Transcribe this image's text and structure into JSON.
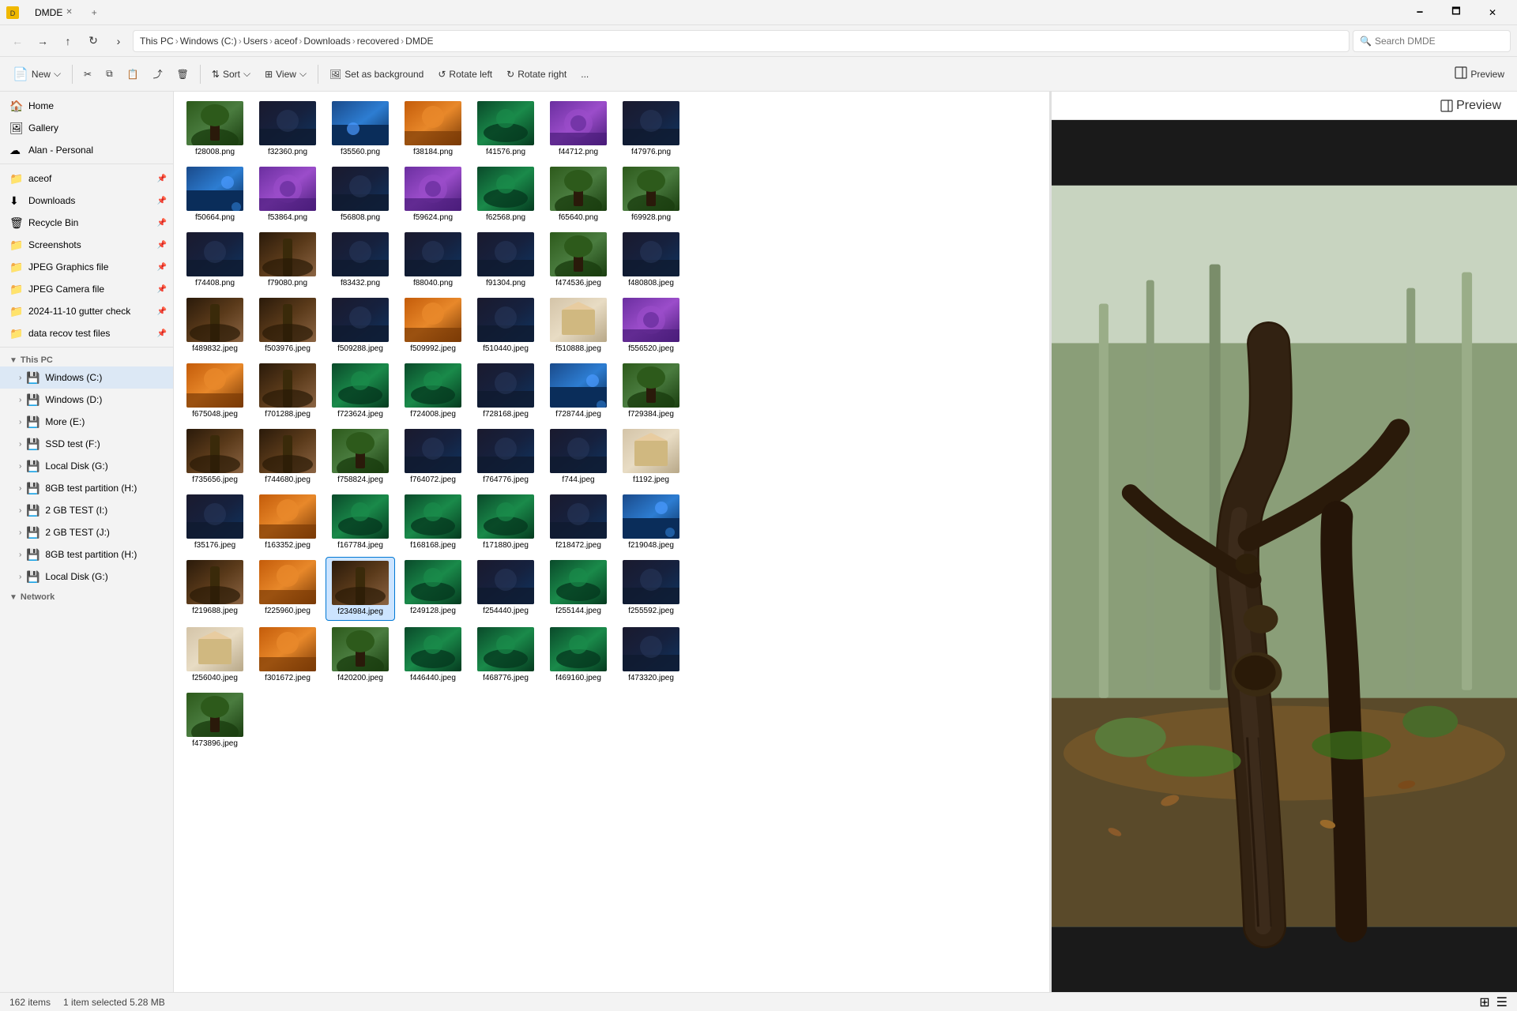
{
  "window": {
    "title": "DMDE",
    "tab_label": "DMDE",
    "minimize": "—",
    "maximize": "□",
    "close": "✕",
    "add_tab": "+"
  },
  "titlebar_controls": {
    "minimize": "🗕",
    "maximize": "🗖",
    "close": "✕"
  },
  "addressbar": {
    "back": "←",
    "forward": "→",
    "up": "↑",
    "refresh": "↻",
    "expand": "›",
    "breadcrumbs": [
      "This PC",
      "Windows (C:)",
      "Users",
      "aceof",
      "Downloads",
      "recovered",
      "DMDE"
    ],
    "search_placeholder": "Search DMDE"
  },
  "toolbar": {
    "new_label": "New",
    "cut_icon": "✂",
    "copy_icon": "⧉",
    "paste_icon": "📋",
    "share_icon": "⤴",
    "delete_icon": "🗑",
    "sort_label": "Sort",
    "view_label": "View",
    "set_background_label": "Set as background",
    "rotate_left_label": "Rotate left",
    "rotate_right_label": "Rotate right",
    "more_icon": "...",
    "preview_label": "Preview"
  },
  "sidebar": {
    "sections": [
      {
        "type": "item",
        "label": "Home",
        "icon": "🏠",
        "indent": 0
      },
      {
        "type": "item",
        "label": "Gallery",
        "icon": "🖼",
        "indent": 0
      },
      {
        "type": "item",
        "label": "Alan - Personal",
        "icon": "☁",
        "indent": 0
      },
      {
        "type": "separator"
      },
      {
        "type": "item",
        "label": "aceof",
        "icon": "📁",
        "indent": 0,
        "pin": true
      },
      {
        "type": "item",
        "label": "Downloads",
        "icon": "⬇",
        "indent": 0,
        "pin": true
      },
      {
        "type": "item",
        "label": "Recycle Bin",
        "icon": "🗑",
        "indent": 0,
        "pin": true
      },
      {
        "type": "item",
        "label": "Screenshots",
        "icon": "📁",
        "indent": 0,
        "pin": true
      },
      {
        "type": "item",
        "label": "JPEG Graphics file",
        "icon": "📁",
        "indent": 0,
        "pin": true
      },
      {
        "type": "item",
        "label": "JPEG Camera file",
        "icon": "📁",
        "indent": 0,
        "pin": true
      },
      {
        "type": "item",
        "label": "2024-11-10 gutter check",
        "icon": "📁",
        "indent": 0,
        "pin": true
      },
      {
        "type": "item",
        "label": "data recov test files",
        "icon": "📁",
        "indent": 0,
        "pin": true
      },
      {
        "type": "separator"
      },
      {
        "type": "section",
        "label": "This PC",
        "collapsed": false
      },
      {
        "type": "item",
        "label": "Windows (C:)",
        "icon": "💾",
        "indent": 1,
        "has_arrow": true,
        "active": true
      },
      {
        "type": "item",
        "label": "Windows (D:)",
        "icon": "💾",
        "indent": 1,
        "has_arrow": true
      },
      {
        "type": "item",
        "label": "More (E:)",
        "icon": "💾",
        "indent": 1,
        "has_arrow": true
      },
      {
        "type": "item",
        "label": "SSD test (F:)",
        "icon": "💾",
        "indent": 1,
        "has_arrow": true
      },
      {
        "type": "item",
        "label": "Local Disk (G:)",
        "icon": "💾",
        "indent": 1,
        "has_arrow": true
      },
      {
        "type": "item",
        "label": "8GB test partition (H:)",
        "icon": "💾",
        "indent": 1,
        "has_arrow": true
      },
      {
        "type": "item",
        "label": "2 GB TEST (I:)",
        "icon": "💾",
        "indent": 1,
        "has_arrow": true
      },
      {
        "type": "item",
        "label": "2 GB TEST (J:)",
        "icon": "💾",
        "indent": 1,
        "has_arrow": true
      },
      {
        "type": "item",
        "label": "8GB test partition (H:)",
        "icon": "💾",
        "indent": 1,
        "has_arrow": true
      },
      {
        "type": "item",
        "label": "Local Disk (G:)",
        "icon": "💾",
        "indent": 1,
        "has_arrow": true
      },
      {
        "type": "section",
        "label": "Network",
        "collapsed": false
      }
    ]
  },
  "files": [
    {
      "name": "f28008.png",
      "color": "forest",
      "selected": false
    },
    {
      "name": "f32360.png",
      "color": "dark",
      "selected": false
    },
    {
      "name": "f35560.png",
      "color": "fantasy",
      "selected": false
    },
    {
      "name": "f38184.png",
      "color": "orange",
      "selected": false
    },
    {
      "name": "f41576.png",
      "color": "alien",
      "selected": false
    },
    {
      "name": "f44712.png",
      "color": "purple",
      "selected": false
    },
    {
      "name": "f47976.png",
      "color": "dark",
      "selected": false
    },
    {
      "name": "f50664.png",
      "color": "fantasy",
      "selected": false
    },
    {
      "name": "f53864.png",
      "color": "purple",
      "selected": false
    },
    {
      "name": "f56808.png",
      "color": "dark",
      "selected": false
    },
    {
      "name": "f59624.png",
      "color": "purple",
      "selected": false
    },
    {
      "name": "f62568.png",
      "color": "alien",
      "selected": false
    },
    {
      "name": "f65640.png",
      "color": "forest",
      "selected": false
    },
    {
      "name": "f69928.png",
      "color": "forest",
      "selected": false
    },
    {
      "name": "f74408.png",
      "color": "dark",
      "selected": false
    },
    {
      "name": "f79080.png",
      "color": "tree",
      "selected": false
    },
    {
      "name": "f83432.png",
      "color": "dark",
      "selected": false
    },
    {
      "name": "f88040.png",
      "color": "dark",
      "selected": false
    },
    {
      "name": "f91304.png",
      "color": "dark",
      "selected": false
    },
    {
      "name": "f474536.jpeg",
      "color": "forest",
      "selected": false
    },
    {
      "name": "f480808.jpeg",
      "color": "dark",
      "selected": false
    },
    {
      "name": "f489832.jpeg",
      "color": "tree",
      "selected": false
    },
    {
      "name": "f503976.jpeg",
      "color": "tree",
      "selected": false
    },
    {
      "name": "f509288.jpeg",
      "color": "dark",
      "selected": false
    },
    {
      "name": "f509992.jpeg",
      "color": "orange",
      "selected": false
    },
    {
      "name": "f510440.jpeg",
      "color": "dark",
      "selected": false
    },
    {
      "name": "f510888.jpeg",
      "color": "box",
      "selected": false
    },
    {
      "name": "f556520.jpeg",
      "color": "purple",
      "selected": false
    },
    {
      "name": "f675048.jpeg",
      "color": "orange",
      "selected": false
    },
    {
      "name": "f701288.jpeg",
      "color": "tree",
      "selected": false
    },
    {
      "name": "f723624.jpeg",
      "color": "alien",
      "selected": false
    },
    {
      "name": "f724008.jpeg",
      "color": "alien",
      "selected": false
    },
    {
      "name": "f728168.jpeg",
      "color": "dark",
      "selected": false
    },
    {
      "name": "f728744.jpeg",
      "color": "fantasy",
      "selected": false
    },
    {
      "name": "f729384.jpeg",
      "color": "forest",
      "selected": false
    },
    {
      "name": "f735656.jpeg",
      "color": "tree",
      "selected": false
    },
    {
      "name": "f744680.jpeg",
      "color": "tree",
      "selected": false
    },
    {
      "name": "f758824.jpeg",
      "color": "forest",
      "selected": false
    },
    {
      "name": "f764072.jpeg",
      "color": "dark",
      "selected": false
    },
    {
      "name": "f764776.jpeg",
      "color": "dark",
      "selected": false
    },
    {
      "name": "f744.jpeg",
      "color": "dark",
      "selected": false
    },
    {
      "name": "f1192.jpeg",
      "color": "box",
      "selected": false
    },
    {
      "name": "f35176.jpeg",
      "color": "dark",
      "selected": false
    },
    {
      "name": "f163352.jpeg",
      "color": "orange",
      "selected": false
    },
    {
      "name": "f167784.jpeg",
      "color": "alien",
      "selected": false
    },
    {
      "name": "f168168.jpeg",
      "color": "alien",
      "selected": false
    },
    {
      "name": "f171880.jpeg",
      "color": "alien",
      "selected": false
    },
    {
      "name": "f218472.jpeg",
      "color": "dark",
      "selected": false
    },
    {
      "name": "f219048.jpeg",
      "color": "fantasy",
      "selected": false
    },
    {
      "name": "f219688.jpeg",
      "color": "tree",
      "selected": false
    },
    {
      "name": "f225960.jpeg",
      "color": "orange",
      "selected": false
    },
    {
      "name": "f234984.jpeg",
      "color": "tree",
      "selected": true
    },
    {
      "name": "f249128.jpeg",
      "color": "alien",
      "selected": false
    },
    {
      "name": "f254440.jpeg",
      "color": "dark",
      "selected": false
    },
    {
      "name": "f255144.jpeg",
      "color": "alien",
      "selected": false
    },
    {
      "name": "f255592.jpeg",
      "color": "dark",
      "selected": false
    },
    {
      "name": "f256040.jpeg",
      "color": "box",
      "selected": false
    },
    {
      "name": "f301672.jpeg",
      "color": "orange",
      "selected": false
    },
    {
      "name": "f420200.jpeg",
      "color": "forest",
      "selected": false
    },
    {
      "name": "f446440.jpeg",
      "color": "alien",
      "selected": false
    },
    {
      "name": "f468776.jpeg",
      "color": "alien",
      "selected": false
    },
    {
      "name": "f469160.jpeg",
      "color": "alien",
      "selected": false
    },
    {
      "name": "f473320.jpeg",
      "color": "dark",
      "selected": false
    },
    {
      "name": "f473896.jpeg",
      "color": "forest",
      "selected": false
    }
  ],
  "preview": {
    "label": "Preview",
    "selected_file": "f234984.jpeg",
    "selected_size": "5.28 MB"
  },
  "statusbar": {
    "item_count": "162 items",
    "selected_info": "1 item selected  5.28 MB"
  },
  "colors": {
    "forest": "#3a6b2a",
    "purple": "#6b2fa0",
    "fantasy": "#1a4a8a",
    "dark": "#1a1a2e",
    "orange": "#c45c0a",
    "alien": "#0a4a2a",
    "box": "#d4c4a8",
    "tree": "#5a3a1a"
  }
}
